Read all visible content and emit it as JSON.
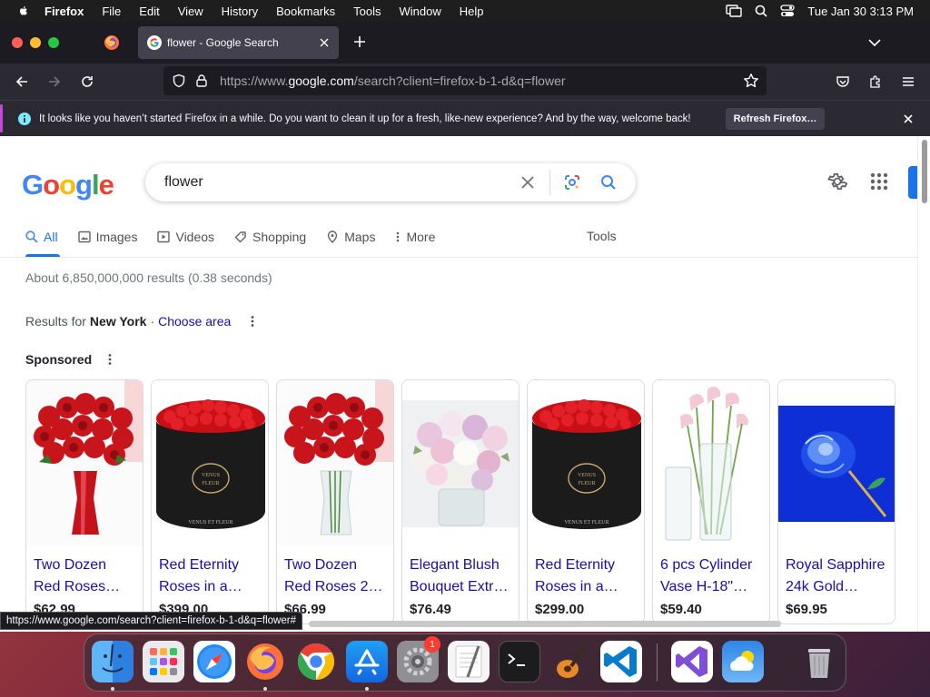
{
  "menubar": {
    "app_name": "Firefox",
    "items": [
      "File",
      "Edit",
      "View",
      "History",
      "Bookmarks",
      "Tools",
      "Window",
      "Help"
    ],
    "clock": "Tue Jan 30  3:13 PM"
  },
  "browser": {
    "tab_title": "flower - Google Search",
    "url_host_prefix": "https://www.",
    "url_host": "google.com",
    "url_path": "/search?client=firefox-b-1-d&q=flower",
    "notification": {
      "text": "It looks like you haven’t started Firefox in a while. Do you want to clean it up for a fresh, like-new experience? And by the way, welcome back!",
      "button": "Refresh Firefox…"
    },
    "status_url": "https://www.google.com/search?client=firefox-b-1-d&q=flower#"
  },
  "google": {
    "logo": [
      "G",
      "o",
      "o",
      "g",
      "l",
      "e"
    ],
    "logo_colors": [
      "#4285f4",
      "#ea4335",
      "#fbbc05",
      "#4285f4",
      "#34a853",
      "#ea4335"
    ],
    "query": "flower",
    "tabs": [
      "All",
      "Images",
      "Videos",
      "Shopping",
      "Maps",
      "More"
    ],
    "tools": "Tools",
    "result_stats": "About 6,850,000,000 results (0.38 seconds)",
    "results_for_prefix": "Results for",
    "results_for_city": "New York",
    "separator": "·",
    "choose_area": "Choose area",
    "sponsored": "Sponsored",
    "products": [
      {
        "title": "Two Dozen Red Roses…",
        "price": "$62.99"
      },
      {
        "title": "Red Eternity Roses in a…",
        "price": "$399.00"
      },
      {
        "title": "Two Dozen Red Roses 2…",
        "price": "$66.99"
      },
      {
        "title": "Elegant Blush Bouquet Extr…",
        "price": "$76.49"
      },
      {
        "title": "Red Eternity Roses in a…",
        "price": "$299.00"
      },
      {
        "title": "6 pcs Cylinder Vase H-18\"…",
        "price": "$59.40"
      },
      {
        "title": "Royal Sapphire 24k Gold…",
        "price": "$69.95"
      }
    ],
    "vase_text": "VENUS ET FLEUR"
  },
  "dock": {
    "apps": [
      "finder-icon",
      "launchpad-icon",
      "safari-icon",
      "firefox-icon",
      "chrome-icon",
      "app-store-icon",
      "system-settings-icon",
      "textedit-icon",
      "terminal-icon",
      "garageband-icon",
      "vscode-icon",
      "visual-studio-icon",
      "weather-icon",
      "trash-icon"
    ],
    "settings_badge": "1"
  }
}
